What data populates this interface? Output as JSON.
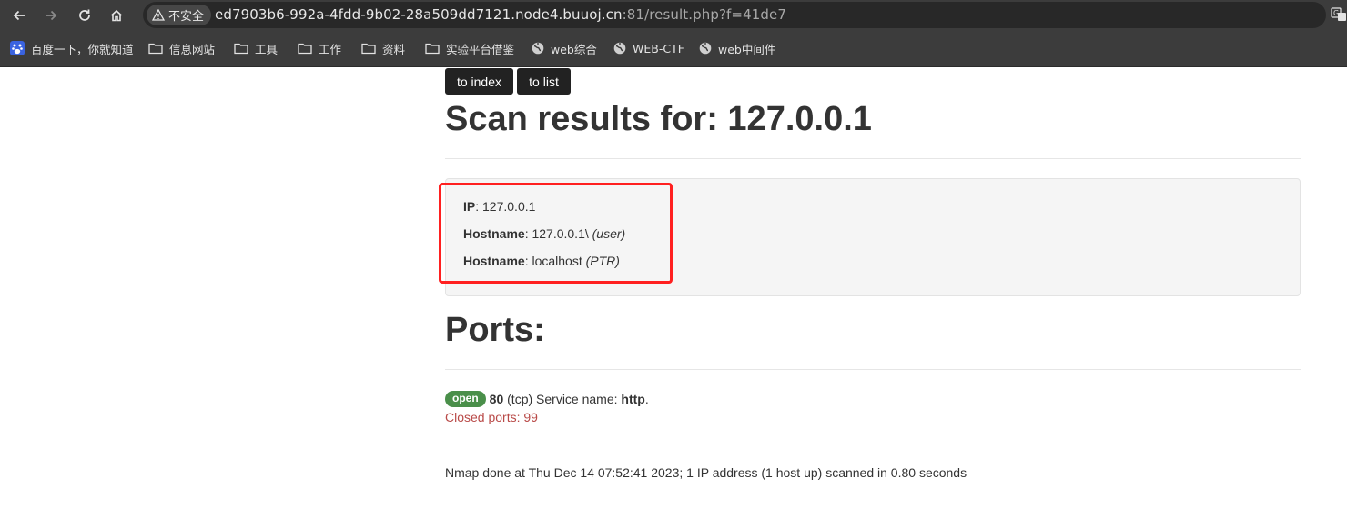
{
  "browser": {
    "security_label": "不安全",
    "url_host": "ed7903b6-992a-4fdd-9b02-28a509dd7121.node4.buuoj.cn",
    "url_path": ":81/result.php?f=41de7",
    "bookmarks": [
      {
        "label": "百度一下，你就知道",
        "icon": "baidu-icon"
      },
      {
        "label": "信息网站",
        "icon": "folder-icon"
      },
      {
        "label": "工具",
        "icon": "folder-icon"
      },
      {
        "label": "工作",
        "icon": "folder-icon"
      },
      {
        "label": "资料",
        "icon": "folder-icon"
      },
      {
        "label": "实验平台借鉴",
        "icon": "folder-icon"
      },
      {
        "label": "web综合",
        "icon": "globe-icon"
      },
      {
        "label": "WEB-CTF",
        "icon": "globe-icon"
      },
      {
        "label": "web中间件",
        "icon": "globe-icon"
      }
    ]
  },
  "page": {
    "buttons": {
      "to_index": "to index",
      "to_list": "to list"
    },
    "title": "Scan results for: 127.0.0.1",
    "host_info": {
      "ip_label": "IP",
      "ip_value": ": 127.0.0.1",
      "hostname1_label": "Hostname",
      "hostname1_value": ": 127.0.0.1\\ ",
      "hostname1_type": "(user)",
      "hostname2_label": "Hostname",
      "hostname2_value": ": localhost ",
      "hostname2_type": "(PTR)"
    },
    "ports_heading": "Ports:",
    "port": {
      "state": "open",
      "number": "80",
      "protocol": " (tcp) Service name: ",
      "service": "http",
      "end": "."
    },
    "closed_ports": "Closed ports: 99",
    "footer": "Nmap done at Thu Dec 14 07:52:41 2023; 1 IP address (1 host up) scanned in 0.80 seconds"
  },
  "colors": {
    "chrome": "#3c3c3c",
    "highlight_box": "#ff2020",
    "badge_open": "#4a8f4a",
    "closed_text": "#b94a48"
  }
}
